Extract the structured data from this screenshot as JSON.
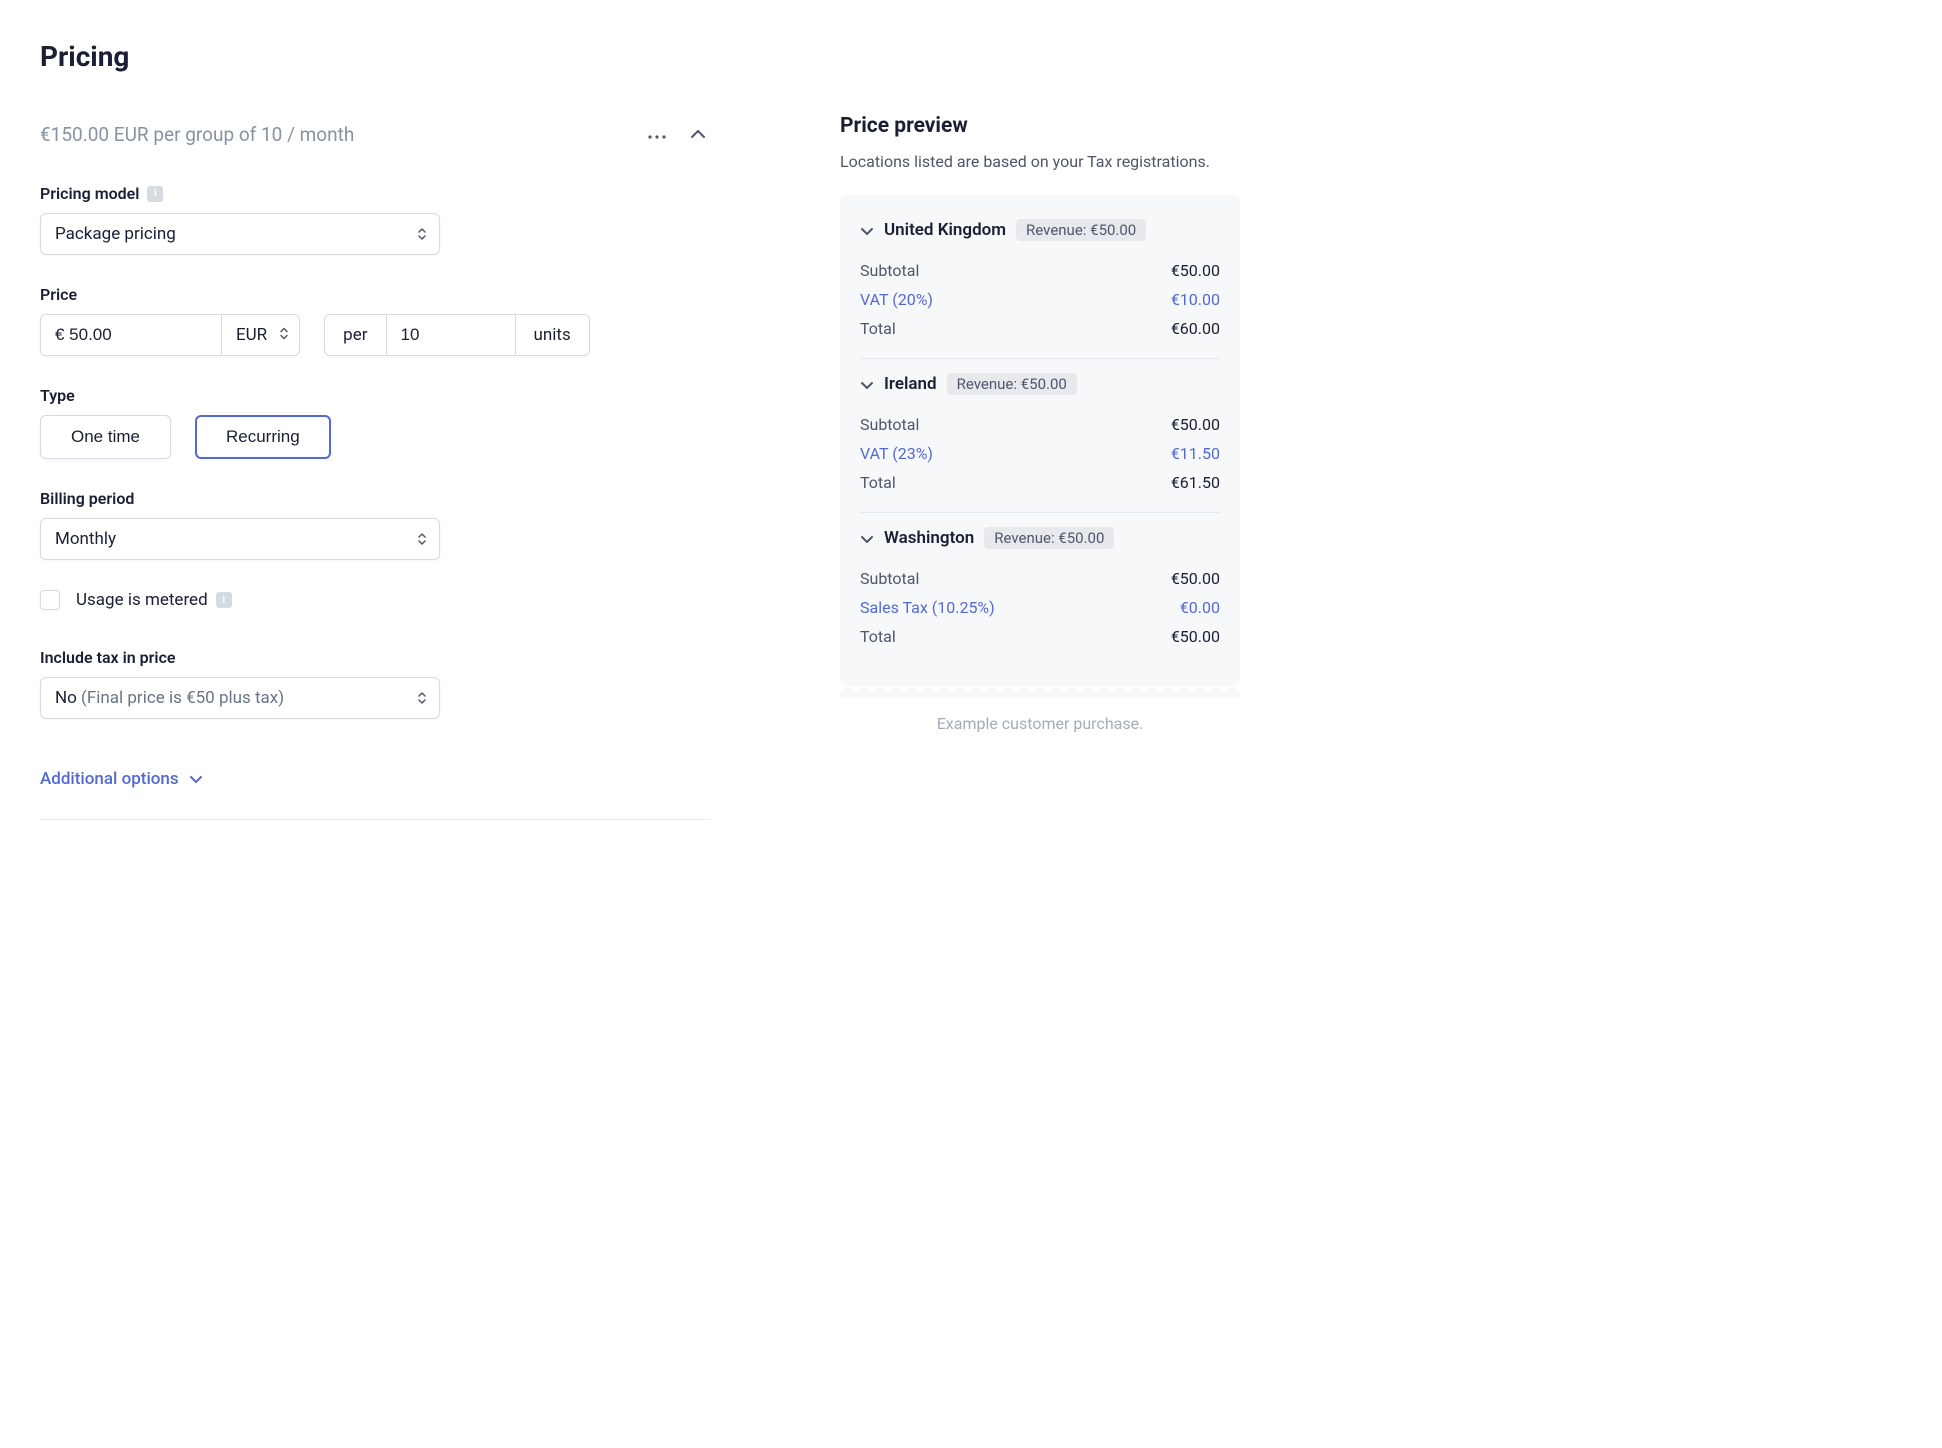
{
  "title": "Pricing",
  "summary": "€150.00 EUR per group of 10 / month",
  "pricingModel": {
    "label": "Pricing model",
    "value": "Package pricing"
  },
  "price": {
    "label": "Price",
    "amount": "€ 50.00",
    "currency": "EUR",
    "per": "per",
    "quantity": "10",
    "units": "units"
  },
  "type": {
    "label": "Type",
    "options": [
      "One time",
      "Recurring"
    ]
  },
  "billingPeriod": {
    "label": "Billing period",
    "value": "Monthly"
  },
  "metered": {
    "label": "Usage is metered"
  },
  "includeTax": {
    "label": "Include tax in price",
    "valuePrefix": "No",
    "valueSuffix": "(Final price is €50 plus tax)"
  },
  "additionalOptions": "Additional options",
  "preview": {
    "title": "Price preview",
    "subtitle": "Locations listed are based on your Tax registrations.",
    "locations": [
      {
        "name": "United Kingdom",
        "revenue": "Revenue: €50.00",
        "subtotal": {
          "label": "Subtotal",
          "value": "€50.00"
        },
        "tax": {
          "label": "VAT (20%)",
          "value": "€10.00"
        },
        "total": {
          "label": "Total",
          "value": "€60.00"
        }
      },
      {
        "name": "Ireland",
        "revenue": "Revenue: €50.00",
        "subtotal": {
          "label": "Subtotal",
          "value": "€50.00"
        },
        "tax": {
          "label": "VAT (23%)",
          "value": "€11.50"
        },
        "total": {
          "label": "Total",
          "value": "€61.50"
        }
      },
      {
        "name": "Washington",
        "revenue": "Revenue: €50.00",
        "subtotal": {
          "label": "Subtotal",
          "value": "€50.00"
        },
        "tax": {
          "label": "Sales Tax (10.25%)",
          "value": "€0.00"
        },
        "total": {
          "label": "Total",
          "value": "€50.00"
        }
      }
    ],
    "example": "Example customer purchase."
  }
}
